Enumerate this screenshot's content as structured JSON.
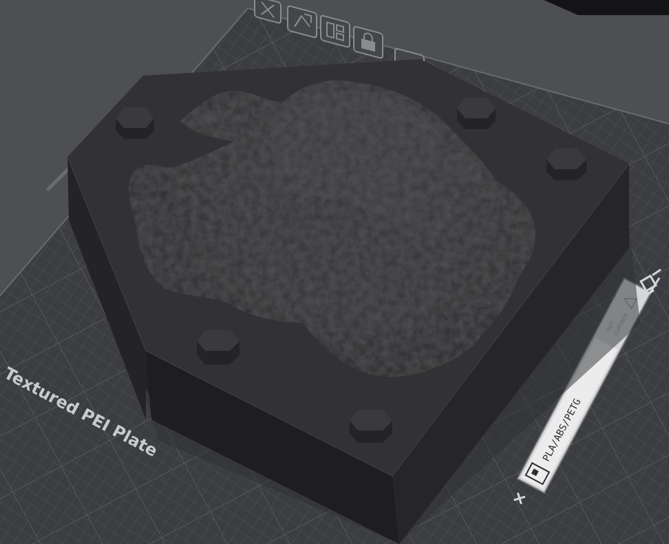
{
  "viewport": {
    "plate_name": "Textured PEI Plate",
    "badge_filament": "PLA/ABS/PETG",
    "badge_surface_line1": "HOT",
    "badge_surface_line2": "SURFACE"
  },
  "plate_toolbar": {
    "icons": [
      "close-icon",
      "auto-orient-icon",
      "arrange-icon",
      "lock-icon",
      "settings-icon"
    ]
  },
  "colors": {
    "background": "#4e4f52",
    "plate": "#3a3b3e",
    "grid": "#55575b",
    "model_top": "#323234",
    "model_side": "#262628",
    "model_front": "#1e1e20"
  }
}
